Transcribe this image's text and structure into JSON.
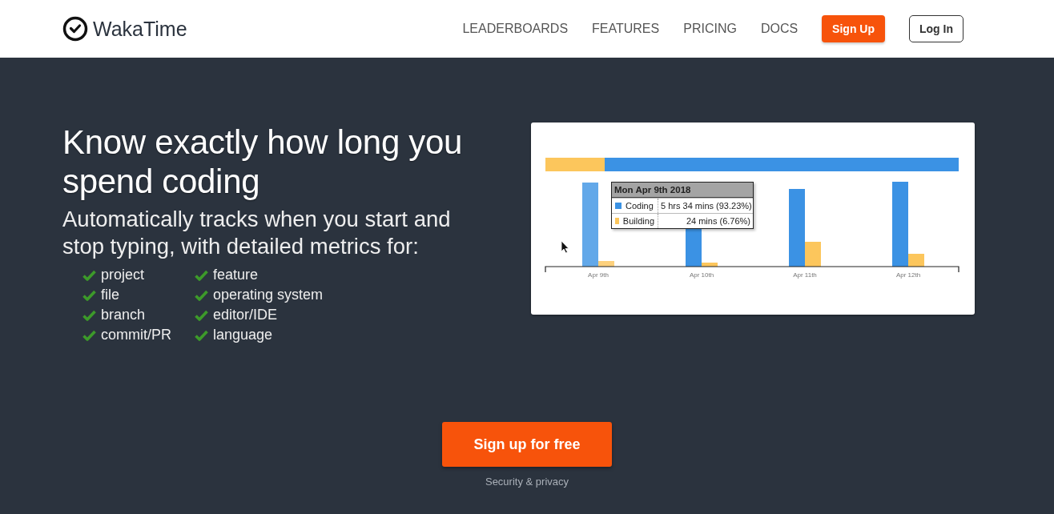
{
  "header": {
    "logo": "WakaTime",
    "nav": [
      "LEADERBOARDS",
      "FEATURES",
      "PRICING",
      "DOCS"
    ],
    "signup": "Sign Up",
    "login": "Log In"
  },
  "hero": {
    "title": "Know exactly how long you spend coding",
    "subtitle": "Automatically tracks when you start and stop typing, with detailed metrics for:",
    "metrics": [
      "project",
      "file",
      "branch",
      "commit/PR",
      "feature",
      "operating system",
      "editor/IDE",
      "language"
    ]
  },
  "chart": {
    "x_labels": [
      "Apr 9th",
      "Apr 10th",
      "Apr 11th",
      "Apr 12th"
    ],
    "tooltip": {
      "title": "Mon Apr 9th 2018",
      "rows": [
        {
          "label": "Coding",
          "value": "5 hrs 34 mins (93.23%)",
          "color": "#3b92e4"
        },
        {
          "label": "Building",
          "value": "24 mins (6.76%)",
          "color": "#fcc65c"
        }
      ]
    }
  },
  "cta": {
    "button": "Sign up for free",
    "link": "Security & privacy"
  }
}
